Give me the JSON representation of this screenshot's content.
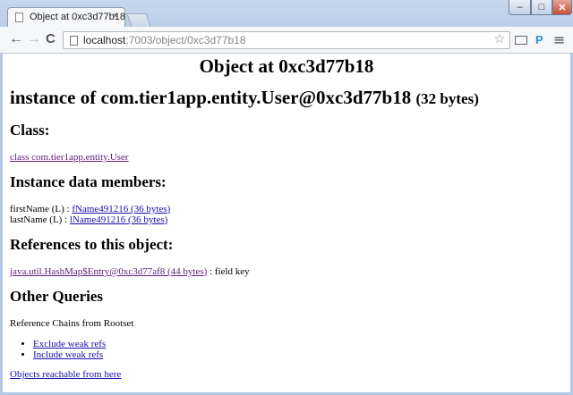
{
  "browser": {
    "tab_title": "Object at 0xc3d77b18",
    "tab_close": "×",
    "url_host": "localhost",
    "url_path": ":7003/object/0xc3d77b18",
    "back": "←",
    "forward": "→",
    "reload": "C",
    "star": "☆",
    "menu": "≡",
    "ext_p": "P",
    "window_controls": {
      "minimize": "–",
      "maximize": "□",
      "close": "✕"
    }
  },
  "page": {
    "title": "Object at 0xc3d77b18",
    "instance_of": "instance of com.tier1app.entity.User@0xc3d77b18",
    "instance_size": "(32 bytes)",
    "class_heading": "Class:",
    "class_link": "class com.tier1app.entity.User",
    "members_heading": "Instance data members:",
    "members": [
      {
        "label": "firstName (L) : ",
        "link": "fName491216 (36 bytes)"
      },
      {
        "label": "lastName (L) : ",
        "link": "lName491216 (36 bytes)"
      }
    ],
    "references_heading": "References to this object:",
    "reference_link": "java.util.HashMap$Entry@0xc3d77af8 (44 bytes)",
    "reference_suffix": " : field key",
    "queries_heading": "Other Queries",
    "chains_text": "Reference Chains from Rootset",
    "chain_options": [
      "Exclude weak refs",
      "Include weak refs"
    ],
    "reachable_link": "Objects reachable from here"
  },
  "colors": {
    "link": "#1a0dab",
    "visited_link": "#60207f",
    "chrome_frame": "#b3c8e4"
  }
}
